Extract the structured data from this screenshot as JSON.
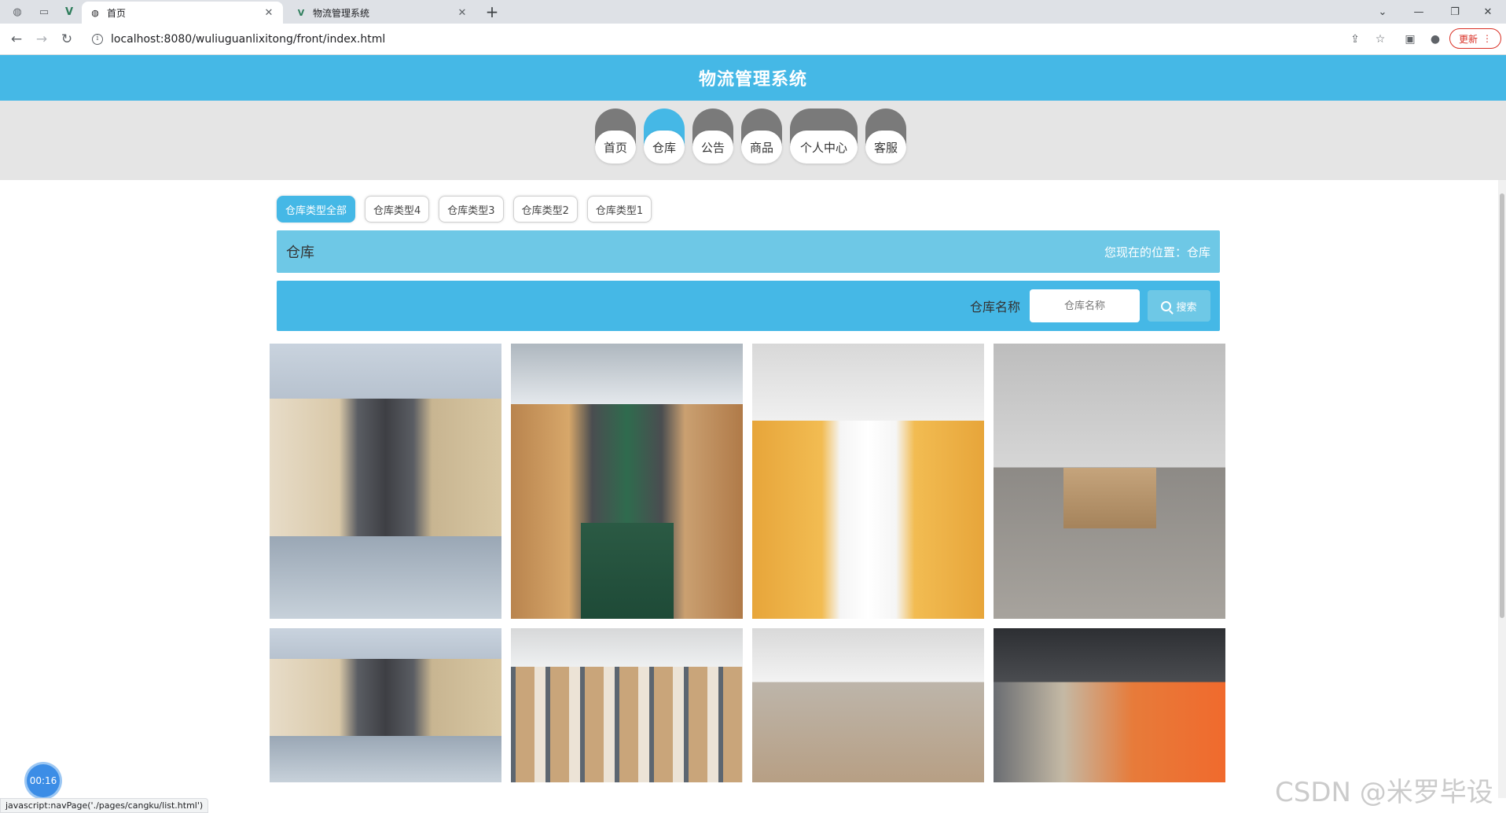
{
  "browser": {
    "tabs": [
      {
        "title": "首页",
        "active": true
      },
      {
        "title": "物流管理系统",
        "active": false
      }
    ],
    "new_tab_icon": "+",
    "url": "localhost:8080/wuliuguanlixitong/front/index.html",
    "update_label": "更新",
    "status_text": "javascript:navPage('./pages/cangku/list.html')"
  },
  "site": {
    "title": "物流管理系统"
  },
  "nav": {
    "items": [
      {
        "label": "首页"
      },
      {
        "label": "仓库"
      },
      {
        "label": "公告"
      },
      {
        "label": "商品"
      },
      {
        "label": "个人中心"
      },
      {
        "label": "客服"
      }
    ],
    "active_index": 1
  },
  "filters": [
    {
      "label": "仓库类型全部",
      "active": true
    },
    {
      "label": "仓库类型4",
      "active": false
    },
    {
      "label": "仓库类型3",
      "active": false
    },
    {
      "label": "仓库类型2",
      "active": false
    },
    {
      "label": "仓库类型1",
      "active": false
    }
  ],
  "crumb": {
    "title": "仓库",
    "location": "您现在的位置：仓库"
  },
  "search": {
    "label": "仓库名称",
    "placeholder": "仓库名称",
    "button_label": "搜索"
  },
  "timer": "00:16",
  "watermark": "CSDN @米罗毕设",
  "colors": {
    "primary": "#45b8e6",
    "primary_light": "#6ec8e6",
    "nav_cap_inactive": "#7a7a7a",
    "nav_bg": "#e5e5e5"
  }
}
